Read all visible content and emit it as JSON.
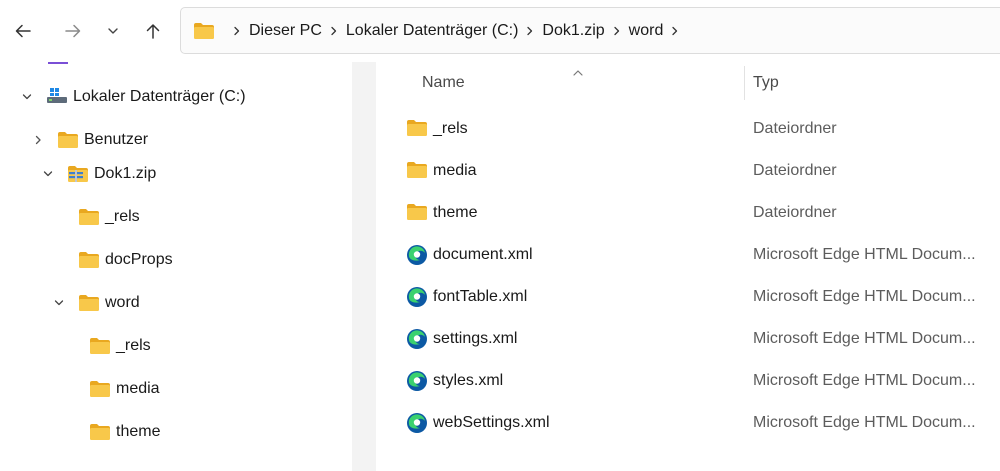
{
  "toolbar": {
    "back_icon": "arrow-left-icon",
    "forward_icon": "arrow-right-icon",
    "recent_icon": "chevron-down-icon",
    "up_icon": "arrow-up-icon"
  },
  "address": {
    "crumbs": [
      "Dieser PC",
      "Lokaler Datenträger (C:)",
      "Dok1.zip",
      "word"
    ]
  },
  "nav": {
    "drive": "Lokaler Datenträger (C:)",
    "benutzer": "Benutzer",
    "zip": "Dok1.zip",
    "rels": "_rels",
    "docprops": "docProps",
    "word": "word",
    "word_rels": "_rels",
    "word_media": "media",
    "word_theme": "theme"
  },
  "columns": {
    "name": "Name",
    "type": "Typ"
  },
  "files": [
    {
      "name": "_rels",
      "type": "Dateiordner",
      "icon": "folder-icon"
    },
    {
      "name": "media",
      "type": "Dateiordner",
      "icon": "folder-icon"
    },
    {
      "name": "theme",
      "type": "Dateiordner",
      "icon": "folder-icon"
    },
    {
      "name": "document.xml",
      "type": "Microsoft Edge HTML Docum...",
      "icon": "edge-icon"
    },
    {
      "name": "fontTable.xml",
      "type": "Microsoft Edge HTML Docum...",
      "icon": "edge-icon"
    },
    {
      "name": "settings.xml",
      "type": "Microsoft Edge HTML Docum...",
      "icon": "edge-icon"
    },
    {
      "name": "styles.xml",
      "type": "Microsoft Edge HTML Docum...",
      "icon": "edge-icon"
    },
    {
      "name": "webSettings.xml",
      "type": "Microsoft Edge HTML Docum...",
      "icon": "edge-icon"
    }
  ],
  "colors": {
    "folder": "#f8c84a",
    "folder_dark": "#e9a820",
    "edge_blue": "#0c59a4",
    "edge_green": "#3bd16f"
  }
}
